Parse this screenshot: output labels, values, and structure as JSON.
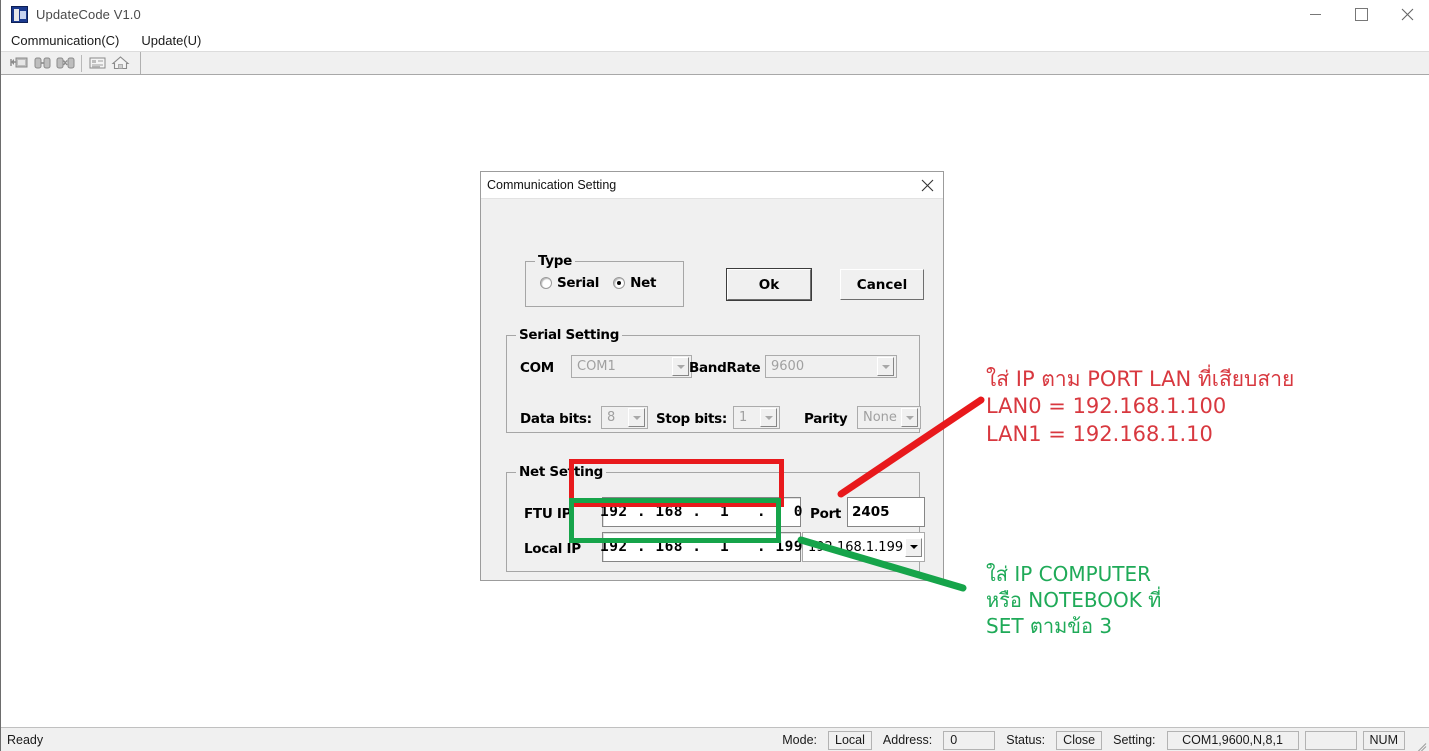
{
  "window": {
    "title": "UpdateCode V1.0",
    "icon": "app-icon",
    "minimize": "−",
    "maximize": "□",
    "close": "✕"
  },
  "menu": {
    "items": [
      {
        "label": "Communication(C)"
      },
      {
        "label": "Update(U)"
      }
    ]
  },
  "toolbar": {
    "buttons": [
      {
        "name": "connect-icon"
      },
      {
        "name": "link-connect-icon"
      },
      {
        "name": "link-disconnect-icon"
      },
      {
        "name": "report-icon"
      },
      {
        "name": "home-icon"
      }
    ]
  },
  "dialog": {
    "title": "Communication Setting",
    "close_label": "✕",
    "type_group": {
      "legend": "Type",
      "options": [
        {
          "label": "Serial",
          "selected": false
        },
        {
          "label": "Net",
          "selected": true
        }
      ]
    },
    "buttons": {
      "ok": "Ok",
      "cancel": "Cancel"
    },
    "serial_group": {
      "legend": "Serial Setting",
      "com_label": "COM",
      "com_value": "COM1",
      "bandrate_label": "BandRate",
      "bandrate_value": "9600",
      "databits_label": "Data bits:",
      "databits_value": "8",
      "stopbits_label": "Stop bits:",
      "stopbits_value": "1",
      "parity_label": "Parity",
      "parity_value": "None"
    },
    "net_group": {
      "legend": "Net Setting",
      "ftu_ip_label": "FTU IP",
      "ftu_ip_value": "192 . 168 .  1   .   0",
      "port_label": "Port",
      "port_value": "2405",
      "local_ip_label": "Local IP",
      "local_ip_value": "192 . 168 .  1   . 199",
      "local_ip_combo_value": "192.168.1.199"
    }
  },
  "annotations": {
    "red": {
      "text": "ใส่ IP ตาม PORT LAN ที่เสียบสาย\nLAN0 = 192.168.1.100\nLAN1 = 192.168.1.10",
      "color": "#d8383f"
    },
    "green": {
      "text": "ใส่ IP COMPUTER\nหรือ NOTEBOOK ที่\nSET ตามข้อ 3",
      "color": "#1faa58"
    },
    "highlight_red_color": "#e8191c",
    "highlight_green_color": "#16a44a"
  },
  "statusbar": {
    "ready": "Ready",
    "mode_label": "Mode:",
    "mode_value": "Local",
    "address_label": "Address:",
    "address_value": "0",
    "status_label": "Status:",
    "status_value": "Close",
    "setting_label": "Setting:",
    "setting_value": "COM1,9600,N,8,1",
    "extra_value": "",
    "num_value": "NUM"
  }
}
